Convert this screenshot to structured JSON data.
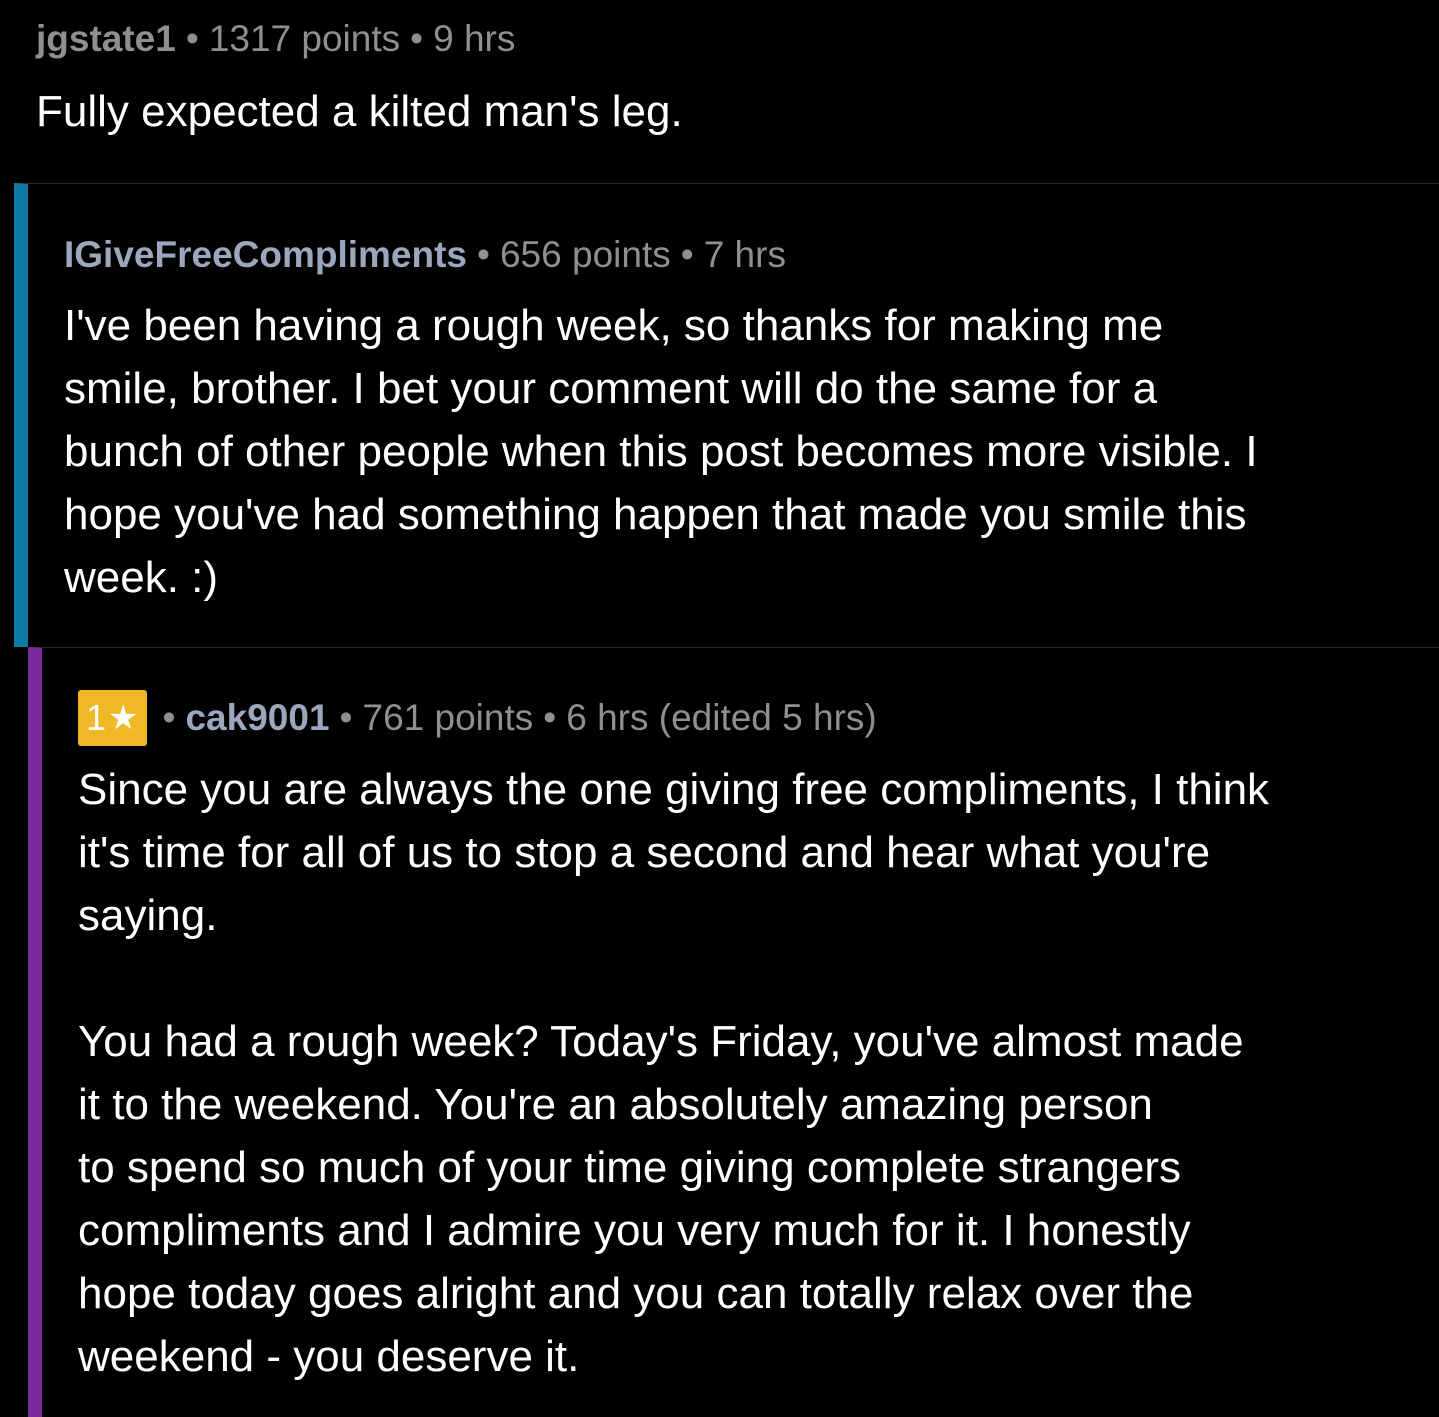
{
  "comments": [
    {
      "author": "jgstate1",
      "points": "1317 points",
      "time": "9 hrs",
      "text": "Fully expected a kilted man's leg."
    },
    {
      "author": "IGiveFreeCompliments",
      "points": "656 points",
      "time": "7 hrs",
      "text": "I've been having a rough week, so thanks for making me\nsmile, brother. I bet your comment will do the same for a\nbunch of other people when this post becomes more visible. I\nhope you've had something happen that made you smile this\nweek. :)"
    },
    {
      "badge_count": "1",
      "badge_icon": "star-icon",
      "author": "cak9001",
      "points": "761 points",
      "time": "6 hrs (edited 5 hrs)",
      "text": "Since you are always the one giving free compliments, I think\nit's time for all of us to stop a second and hear what you're\nsaying.\n\nYou had a rough week? Today's Friday, you've almost made\nit to the weekend. You're an absolutely amazing person\nto spend so much of your time giving complete strangers\ncompliments and I admire you very much for it. I honestly\nhope today goes alright and you can totally relax over the\nweekend - you deserve it."
    }
  ],
  "separator": "•",
  "colors": {
    "background": "#000000",
    "level2_bar": "#0f79a8",
    "level3_bar": "#7a2aa0",
    "badge": "#f0b726"
  }
}
